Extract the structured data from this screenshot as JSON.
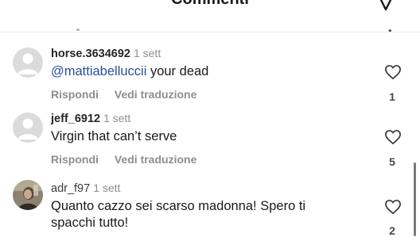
{
  "header": {
    "title": "Commenti"
  },
  "comments": [
    {
      "username": "horse.3634692",
      "time": "1 sett",
      "mention": "@mattiabelluccii",
      "text": " your dead",
      "reply_label": "Rispondi",
      "translate_label": "Vedi traduzione",
      "likes": "1"
    },
    {
      "username": "jeff_6912",
      "time": "1 sett",
      "text": "Virgin that can’t serve",
      "reply_label": "Rispondi",
      "translate_label": "Vedi traduzione",
      "likes": "5"
    },
    {
      "username": "adr_f97",
      "time": "1 sett",
      "text_line1": "Quanto cazzo sei scarso madonna! Spero ti",
      "text_line2": "spacchi tutto!",
      "likes": "2"
    }
  ],
  "icons": {
    "header": "pencil-icon",
    "like": "heart-outline-icon",
    "avatar_default": "default-user-avatar"
  },
  "colors": {
    "mention": "#2b4f9e",
    "muted": "#8e8e8e"
  }
}
